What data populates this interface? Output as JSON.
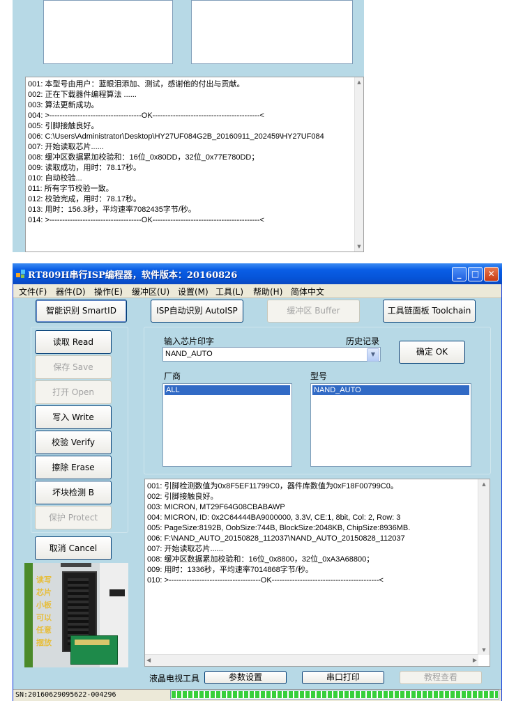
{
  "top_window": {
    "log_lines": [
      "001: 本型号由用户：蓝眼泪添加、测试，感谢他的付出与贡献。",
      "002: 正在下载器件编程算法 ......",
      "003: 算法更新成功。",
      "004: >------------------------------------OK------------------------------------------<",
      "005: 引脚接触良好。",
      "006: C:\\Users\\Administrator\\Desktop\\HY27UF084G2B_20160911_202459\\HY27UF084",
      "007: 开始读取芯片......",
      "008: 缓冲区数据累加校验和：16位_0x80DD，32位_0x77E780DD；",
      "009: 读取成功，用时：78.17秒。",
      "010: 自动校验...",
      "011: 所有字节校验一致。",
      "012: 校验完成，用时：78.17秒。",
      "013: 用时：156.3秒，平均速率7082435字节/秒。",
      "014: >------------------------------------OK------------------------------------------<"
    ]
  },
  "title": "RT809H串行ISP编程器，软件版本：20160826",
  "menu": [
    "文件(F)",
    "器件(D)",
    "操作(E)",
    "缓冲区(U)",
    "设置(M)",
    "工具(L)",
    "帮助(H)",
    "简体中文"
  ],
  "toolbar": {
    "smart_id": "智能识别 SmartID",
    "isp_auto": "ISP自动识别 AutoISP",
    "buffer": "缓冲区 Buffer",
    "toolchain": "工具链面板 Toolchain"
  },
  "side_buttons": {
    "read": "读取 Read",
    "save": "保存 Save",
    "open": "打开 Open",
    "write": "写入 Write",
    "verify": "校验 Verify",
    "erase": "擦除 Erase",
    "bad_block": "坏块检测 B",
    "protect": "保护 Protect",
    "cancel": "取消 Cancel"
  },
  "chip": {
    "input_label": "输入芯片印字",
    "history_label": "历史记录",
    "value": "NAND_AUTO",
    "ok": "确定 OK",
    "vendor_label": "厂商",
    "model_label": "型号",
    "vendor_selected": "ALL",
    "model_selected": "NAND_AUTO"
  },
  "main_log": [
    "001: 引脚检测数值为0x8F5EF11799C0，器件库数值为0xF18F00799C0。",
    "002: 引脚接触良好。",
    "003: MICRON, MT29F64G08CBABAWP",
    "004: MICRON, ID: 0x2C64444BA9000000, 3.3V, CE:1, 8bit, Col: 2, Row: 3",
    "005: PageSize:8192B, OobSize:744B, BlockSize:2048KB, ChipSize:8936MB.",
    "006: F:\\NAND_AUTO_20150828_112037\\NAND_AUTO_20150828_112037",
    "007: 开始读取芯片......",
    "008: 缓冲区数据累加校验和：16位_0x8800，32位_0xA3A68800；",
    "009: 用时：1336秒，平均速率7014868字节/秒。",
    "010: >------------------------------------OK------------------------------------------<"
  ],
  "photo_text": [
    "读写",
    "芯片",
    "小板",
    "可以",
    "任意",
    "摆放"
  ],
  "bottom": {
    "lcd_label": "液晶电视工具",
    "params": "参数设置",
    "serial": "串口打印",
    "tutorial": "教程查看"
  },
  "status": {
    "sn": "SN:20160629095622-004296",
    "progress": 1.0
  },
  "colors": {
    "window_bg": "#b7d9e6",
    "title_blue": "#0654d8",
    "selection": "#316ac5",
    "progress_green": "#37cf3b"
  }
}
